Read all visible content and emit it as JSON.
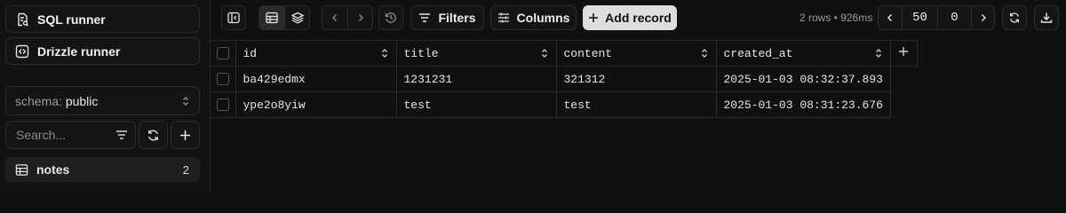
{
  "sidebar": {
    "sql_runner": "SQL runner",
    "drizzle_runner": "Drizzle runner",
    "schema_label": "schema:",
    "schema_value": "public",
    "search_placeholder": "Search...",
    "tables": [
      {
        "name": "notes",
        "count": "2"
      }
    ]
  },
  "toolbar": {
    "filters_label": "Filters",
    "columns_label": "Columns",
    "add_record_label": "Add record",
    "row_info": "2 rows • 926ms",
    "page_limit": "50",
    "page_offset": "0"
  },
  "grid": {
    "columns": [
      "id",
      "title",
      "content",
      "created_at"
    ],
    "rows": [
      [
        "ba429edmx",
        "1231231",
        "321312",
        "2025-01-03 08:32:37.893"
      ],
      [
        "ype2o8yiw",
        "test",
        "test",
        "2025-01-03 08:31:23.676"
      ]
    ]
  },
  "icons": {
    "add_column": "plus-icon"
  },
  "colors": {
    "background": "#101010",
    "primary_button": "#dedede",
    "border": "#2a2a2a"
  }
}
